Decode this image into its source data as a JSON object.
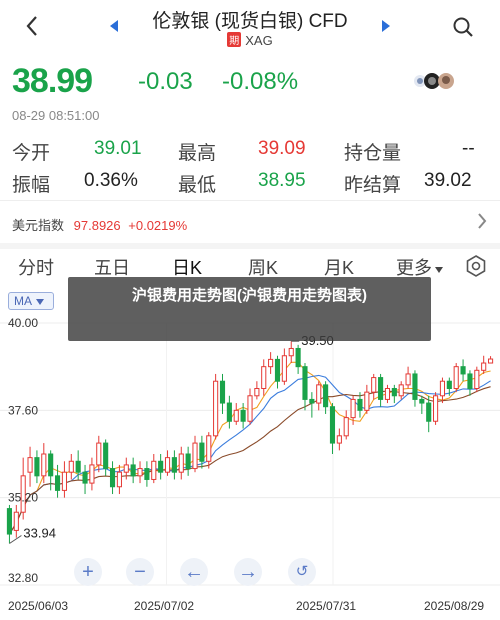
{
  "header": {
    "title": "伦敦银 (现货白银) CFD",
    "tag": "期",
    "symbol": "XAG"
  },
  "quote": {
    "price": "38.99",
    "change": "-0.03",
    "change_pct": "-0.08%",
    "time": "08-29 08:51:00"
  },
  "stats": {
    "open_label": "今开",
    "open": "39.01",
    "high_label": "最高",
    "high": "39.09",
    "oi_label": "持仓量",
    "oi": "--",
    "amp_label": "振幅",
    "amp": "0.36%",
    "low_label": "最低",
    "low": "38.95",
    "settle_label": "昨结算",
    "settle": "39.02"
  },
  "usd_index": {
    "label": "美元指数",
    "value": "97.8926",
    "change": "+0.0219%"
  },
  "tabs": [
    "分时",
    "五日",
    "日K",
    "周K",
    "月K",
    "更多"
  ],
  "active_tab": 2,
  "indicator": "MA",
  "overlay_text": "沪银费用走势图(沪银费用走势图表)",
  "chart_data": {
    "type": "candlestick",
    "y_ticks": [
      "40.00",
      "37.60",
      "35.20",
      "32.80"
    ],
    "ylim": [
      32.8,
      40.0
    ],
    "x_labels": [
      "2025/06/03",
      "2025/07/02",
      "2025/07/31",
      "2025/08/29"
    ],
    "high_label": "39.50",
    "low_label": "33.94",
    "candles": [
      [
        34.9,
        34.2,
        35.0,
        33.94
      ],
      [
        34.3,
        34.8,
        35.0,
        34.1
      ],
      [
        34.8,
        35.8,
        36.3,
        34.6
      ],
      [
        35.9,
        36.3,
        36.6,
        35.5
      ],
      [
        36.3,
        35.8,
        36.5,
        35.6
      ],
      [
        35.8,
        36.4,
        36.7,
        35.6
      ],
      [
        36.4,
        35.8,
        36.5,
        35.4
      ],
      [
        35.8,
        35.4,
        36.1,
        35.2
      ],
      [
        35.4,
        35.9,
        36.2,
        35.2
      ],
      [
        35.9,
        36.2,
        36.4,
        35.7
      ],
      [
        36.2,
        35.9,
        36.5,
        35.7
      ],
      [
        35.9,
        35.6,
        36.1,
        35.3
      ],
      [
        35.6,
        36.1,
        36.3,
        35.4
      ],
      [
        36.1,
        36.7,
        36.9,
        35.9
      ],
      [
        36.7,
        36.0,
        36.8,
        35.8
      ],
      [
        36.0,
        35.5,
        36.2,
        35.3
      ],
      [
        35.5,
        35.9,
        36.1,
        35.3
      ],
      [
        35.9,
        36.1,
        36.3,
        35.7
      ],
      [
        36.1,
        35.8,
        36.3,
        35.6
      ],
      [
        35.8,
        36.0,
        36.2,
        35.6
      ],
      [
        36.0,
        35.7,
        36.2,
        35.5
      ],
      [
        35.7,
        36.2,
        36.4,
        35.6
      ],
      [
        36.2,
        35.9,
        36.4,
        35.7
      ],
      [
        35.9,
        36.3,
        36.5,
        35.8
      ],
      [
        36.3,
        35.9,
        36.5,
        35.7
      ],
      [
        35.9,
        36.4,
        36.6,
        35.7
      ],
      [
        36.4,
        36.0,
        36.6,
        35.8
      ],
      [
        36.0,
        36.7,
        36.9,
        35.9
      ],
      [
        36.7,
        36.2,
        36.9,
        36.0
      ],
      [
        36.2,
        36.9,
        37.0,
        36.0
      ],
      [
        36.9,
        38.4,
        38.6,
        36.8
      ],
      [
        38.4,
        37.8,
        38.6,
        37.5
      ],
      [
        37.8,
        37.3,
        38.0,
        37.1
      ],
      [
        37.3,
        37.6,
        37.8,
        37.2
      ],
      [
        37.6,
        37.3,
        37.8,
        37.1
      ],
      [
        37.3,
        38.0,
        38.2,
        37.2
      ],
      [
        38.0,
        38.2,
        38.4,
        37.9
      ],
      [
        38.2,
        38.8,
        39.0,
        38.0
      ],
      [
        38.8,
        39.0,
        39.2,
        38.6
      ],
      [
        39.0,
        38.4,
        39.1,
        38.2
      ],
      [
        38.4,
        39.1,
        39.3,
        38.3
      ],
      [
        39.1,
        39.3,
        39.5,
        38.9
      ],
      [
        39.3,
        38.8,
        39.4,
        38.6
      ],
      [
        38.8,
        37.9,
        38.9,
        37.6
      ],
      [
        37.9,
        37.8,
        38.1,
        37.4
      ],
      [
        37.8,
        38.3,
        38.4,
        37.6
      ],
      [
        38.3,
        37.7,
        38.4,
        37.5
      ],
      [
        37.7,
        36.7,
        37.8,
        36.4
      ],
      [
        36.7,
        36.9,
        37.1,
        36.5
      ],
      [
        36.9,
        37.4,
        37.6,
        36.8
      ],
      [
        37.4,
        37.9,
        38.0,
        37.2
      ],
      [
        37.9,
        37.6,
        38.1,
        37.4
      ],
      [
        37.6,
        38.1,
        38.3,
        37.5
      ],
      [
        38.1,
        38.5,
        38.6,
        37.9
      ],
      [
        38.5,
        37.9,
        38.6,
        37.7
      ],
      [
        37.9,
        38.2,
        38.3,
        37.8
      ],
      [
        38.2,
        38.0,
        38.3,
        37.8
      ],
      [
        38.0,
        38.3,
        38.4,
        37.9
      ],
      [
        38.3,
        38.6,
        38.8,
        38.2
      ],
      [
        38.6,
        37.9,
        38.7,
        37.7
      ],
      [
        37.9,
        37.8,
        38.0,
        37.5
      ],
      [
        37.8,
        37.3,
        38.0,
        37.0
      ],
      [
        37.3,
        38.0,
        38.1,
        37.2
      ],
      [
        38.0,
        38.4,
        38.5,
        37.8
      ],
      [
        38.4,
        38.2,
        38.5,
        38.0
      ],
      [
        38.2,
        38.8,
        38.9,
        38.1
      ],
      [
        38.8,
        38.6,
        39.0,
        38.4
      ],
      [
        38.6,
        38.2,
        38.7,
        38.0
      ],
      [
        38.2,
        38.7,
        38.8,
        38.1
      ],
      [
        38.7,
        38.9,
        39.1,
        38.6
      ],
      [
        38.9,
        39.01,
        39.09,
        38.95
      ]
    ]
  },
  "icons": {
    "back": "chevron-left-icon",
    "search": "search-icon",
    "settings": "gear-icon",
    "zoom_in": "plus-icon",
    "zoom_out": "minus-icon",
    "pan_left": "arrow-left-icon",
    "pan_right": "arrow-right-icon",
    "reset": "reset-icon"
  },
  "colors": {
    "up": "#e53935",
    "down": "#1aa34a",
    "accent": "#2a6ed8"
  }
}
